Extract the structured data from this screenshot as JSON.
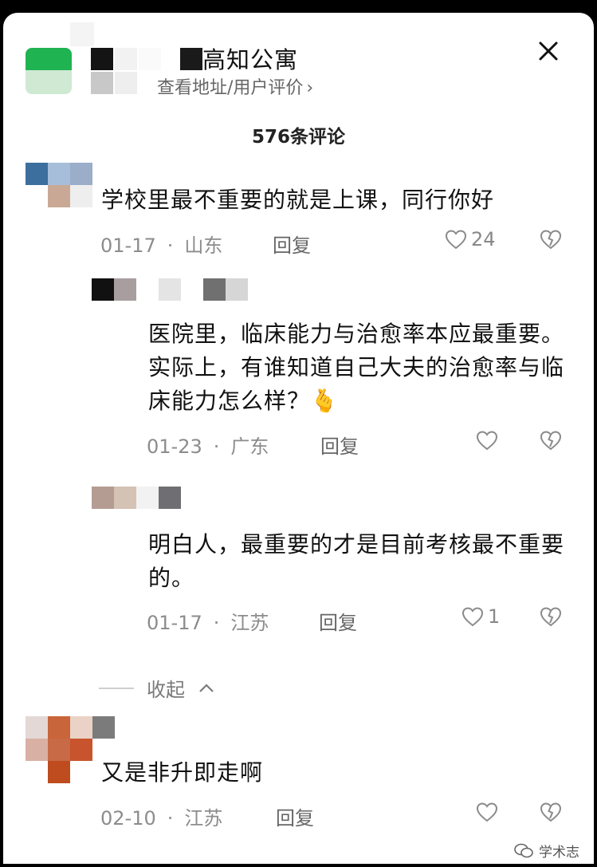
{
  "header": {
    "title": "高知公寓",
    "subtitle": "查看地址/用户评价",
    "subtitle_chevron": "›"
  },
  "comment_count": "576条评论",
  "comments": [
    {
      "text": "学校里最不重要的就是上课，同行你好",
      "date": "01-17",
      "dot": "·",
      "region": "山东",
      "reply": "回复",
      "likes": "24"
    },
    {
      "text": "医院里，临床能力与治愈率本应最重要。实际上，有谁知道自己大夫的治愈率与临床能力怎么样？🫰",
      "date": "01-23",
      "dot": "·",
      "region": "广东",
      "reply": "回复",
      "likes": ""
    },
    {
      "text": "明白人，最重要的才是目前考核最不重要的。",
      "date": "01-17",
      "dot": "·",
      "region": "江苏",
      "reply": "回复",
      "likes": "1"
    },
    {
      "text": "又是非升即走啊",
      "date": "02-10",
      "dot": "·",
      "region": "江苏",
      "reply": "回复",
      "likes": ""
    }
  ],
  "collapse_label": "收起",
  "collapse_icon": "^",
  "watermark": "学术志",
  "icons": {
    "close": "close-icon",
    "like": "heart-outline-icon",
    "dislike": "broken-heart-icon",
    "watermark": "wechat-icon"
  },
  "colors": {
    "avatar_green": "#1fb352",
    "meta_gray": "#8c8c8c",
    "text": "#111111"
  }
}
